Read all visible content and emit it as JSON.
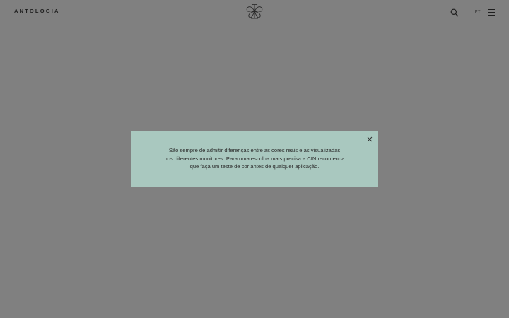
{
  "header": {
    "brand": "ANTOLOGIA",
    "logo_icon": "ornate-monogram-icon",
    "search_icon": "search-icon",
    "language": "PT",
    "menu_icon": "hamburger-menu-icon"
  },
  "modal": {
    "close_icon": "close-icon",
    "lines": [
      "São sempre de admitir diferenças entre as cores reais e as visualizadas",
      "nos diferentes monitores. Para uma escolha mais precisa a CIN recomenda",
      "que faça um teste de cor antes de qualquer aplicação."
    ]
  },
  "colors": {
    "background": "#808080",
    "modal_background": "#a9c8bf",
    "text": "#2b2b2b"
  }
}
